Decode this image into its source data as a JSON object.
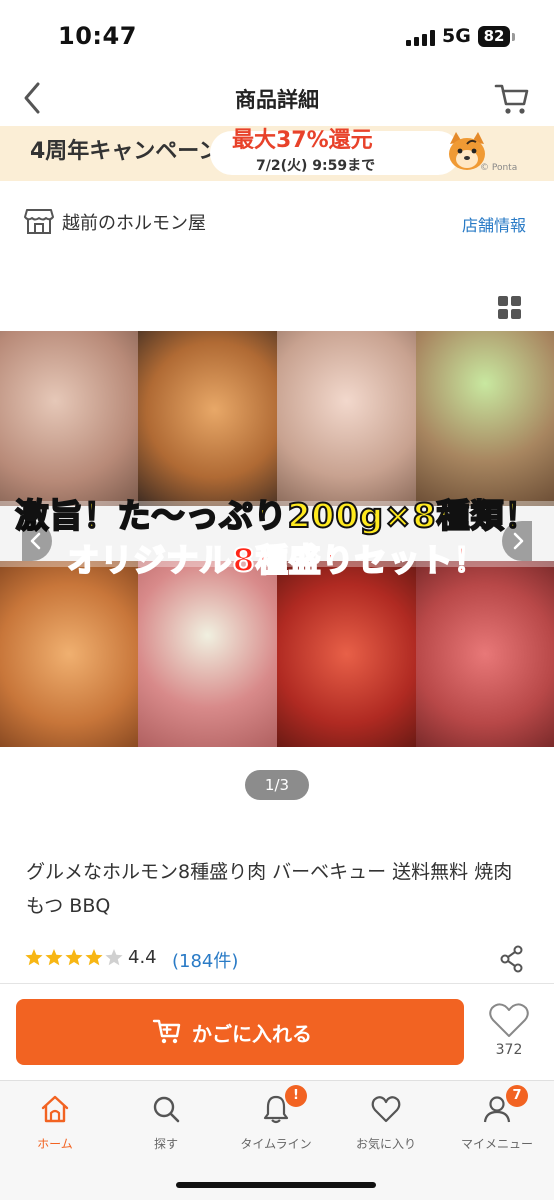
{
  "status": {
    "time": "10:47",
    "network": "5G",
    "battery": "82"
  },
  "header": {
    "title": "商品詳細"
  },
  "banner": {
    "campaign": "4周年キャンペーン",
    "deal": "最大37%還元",
    "until": "7/2(火) 9:59まで",
    "credit": "© Ponta"
  },
  "store": {
    "name": "越前のホルモン屋",
    "info_link": "店舗情報"
  },
  "product_image": {
    "headline": "激旨！た～っぷり200g×8種類！",
    "subline": "オリジナル8種盛りセット！",
    "pager": "1/3"
  },
  "product": {
    "title": "グルメなホルモン8種盛り肉 バーベキュー 送料無料 焼肉 もつ BBQ",
    "rating": "4.4",
    "rating_stars": 4.4,
    "review_count": "(184件)"
  },
  "actions": {
    "add_to_cart": "かごに入れる",
    "favorite_count": "372"
  },
  "tabbar": {
    "items": [
      {
        "label": "ホーム",
        "icon": "home-icon",
        "active": true
      },
      {
        "label": "探す",
        "icon": "search-icon"
      },
      {
        "label": "タイムライン",
        "icon": "bell-icon",
        "badge": "!"
      },
      {
        "label": "お気に入り",
        "icon": "heart-icon"
      },
      {
        "label": "マイメニュー",
        "icon": "person-icon",
        "badge": "7"
      }
    ]
  },
  "colors": {
    "accent": "#f26322",
    "link": "#2a7bc6"
  }
}
